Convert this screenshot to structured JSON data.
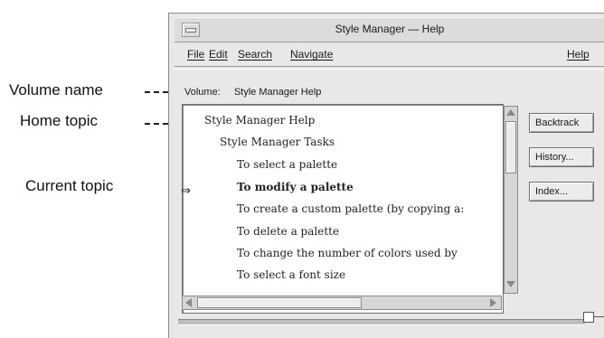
{
  "annotations": {
    "volume_name": "Volume name",
    "home_topic": "Home topic",
    "current_topic": "Current topic"
  },
  "window": {
    "title": "Style Manager — Help"
  },
  "menu": {
    "file": "File",
    "edit": "Edit",
    "search": "Search",
    "navigate": "Navigate",
    "help": "Help"
  },
  "volume": {
    "label": "Volume:",
    "name": "Style Manager Help"
  },
  "topics": [
    "Style Manager Help",
    "Style Manager Tasks",
    "To select a palette",
    "To modify a palette",
    "To create a custom palette (by copying a:",
    "To delete a palette",
    "To change the number of colors used by",
    "To select a font size"
  ],
  "current_topic_marker": "⇒",
  "buttons": {
    "backtrack": "Backtrack",
    "history": "History...",
    "index": "Index..."
  }
}
